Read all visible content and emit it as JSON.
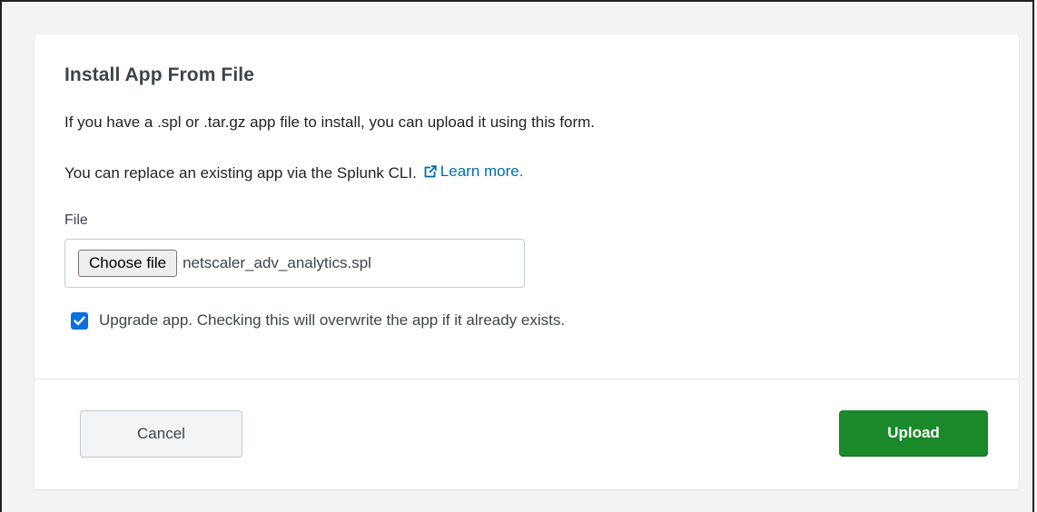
{
  "modal": {
    "title": "Install App From File",
    "description_1": "If you have a .spl or .tar.gz app file to install, you can upload it using this form.",
    "description_2": "You can replace an existing app via the Splunk CLI.",
    "learn_more_link": "Learn more.",
    "learn_more_icon": "external-link-icon"
  },
  "file_field": {
    "label": "File",
    "choose_button_label": "Choose file",
    "selected_file": "netscaler_adv_analytics.spl"
  },
  "upgrade_option": {
    "checked": true,
    "label": "Upgrade app. Checking this will overwrite the app if it already exists.",
    "icon": "checkmark-icon"
  },
  "footer": {
    "cancel_label": "Cancel",
    "upload_label": "Upload"
  },
  "colors": {
    "link": "#006eaa",
    "primary_button": "#1a8929",
    "checkbox": "#0a6fdf"
  }
}
